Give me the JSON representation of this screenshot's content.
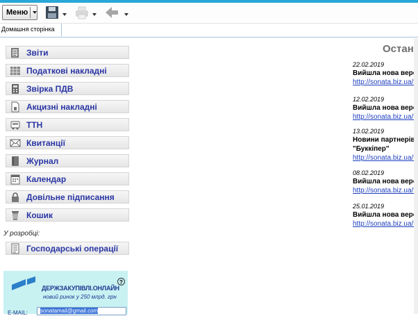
{
  "toolbar": {
    "menu_label": "Меню",
    "save_icon": "save-icon",
    "print_icon": "printer-icon",
    "back_icon": "back-arrow-icon"
  },
  "tabs": [
    {
      "label": "Домашня сторінка"
    }
  ],
  "nav": {
    "items": [
      {
        "label": "Звіти",
        "icon": "reports-icon"
      },
      {
        "label": "Податкові накладні",
        "icon": "tax-invoices-icon"
      },
      {
        "label": "Звірка ПДВ",
        "icon": "calculator-icon"
      },
      {
        "label": "Акцизні накладні",
        "icon": "excise-doc-icon"
      },
      {
        "label": "ТТН",
        "icon": "truck-icon"
      },
      {
        "label": "Квитанції",
        "icon": "envelope-icon"
      },
      {
        "label": "Журнал",
        "icon": "journal-icon"
      },
      {
        "label": "Календар",
        "icon": "calendar-icon"
      },
      {
        "label": "Довільне підписання",
        "icon": "lock-icon"
      },
      {
        "label": "Кошик",
        "icon": "trash-icon"
      }
    ],
    "dev_label": "У розробці:",
    "dev_items": [
      {
        "label": "Господарські операції",
        "icon": "document-lines-icon"
      }
    ]
  },
  "promo": {
    "title": "ДЕРЖЗАКУПІВЛІ.ОНЛАЙН",
    "subtitle": "новий ринок у 250 млрд. грн",
    "email_label": "E-MAIL:",
    "email_value": "sonatamail@gmail.com",
    "help_icon": "help-icon"
  },
  "news": {
    "heading": "Останні",
    "items": [
      {
        "date": "22.02.2019",
        "title": "Вийшла нова версія",
        "link": "http://sonata.biz.ua/to"
      },
      {
        "date": "12.02.2019",
        "title": "Вийшла нова версія",
        "link": "http://sonata.biz.ua/to"
      },
      {
        "date": "13.02.2019",
        "title": "Новини партнерів -",
        "title2": "\"Буккіпер\"",
        "link": "http://sonata.biz.ua/to"
      },
      {
        "date": "08.02.2019",
        "title": "Вийшла нова версія",
        "link": "http://sonata.biz.ua/to"
      },
      {
        "date": "25.01.2019",
        "title": "Вийшла нова версія",
        "link": "http://sonata.biz.ua/to"
      }
    ]
  },
  "colors": {
    "accent": "#29a7d8",
    "nav_text": "#2a36a4",
    "link": "#1e3fbf",
    "promo_bg": "#c8f1f2"
  }
}
